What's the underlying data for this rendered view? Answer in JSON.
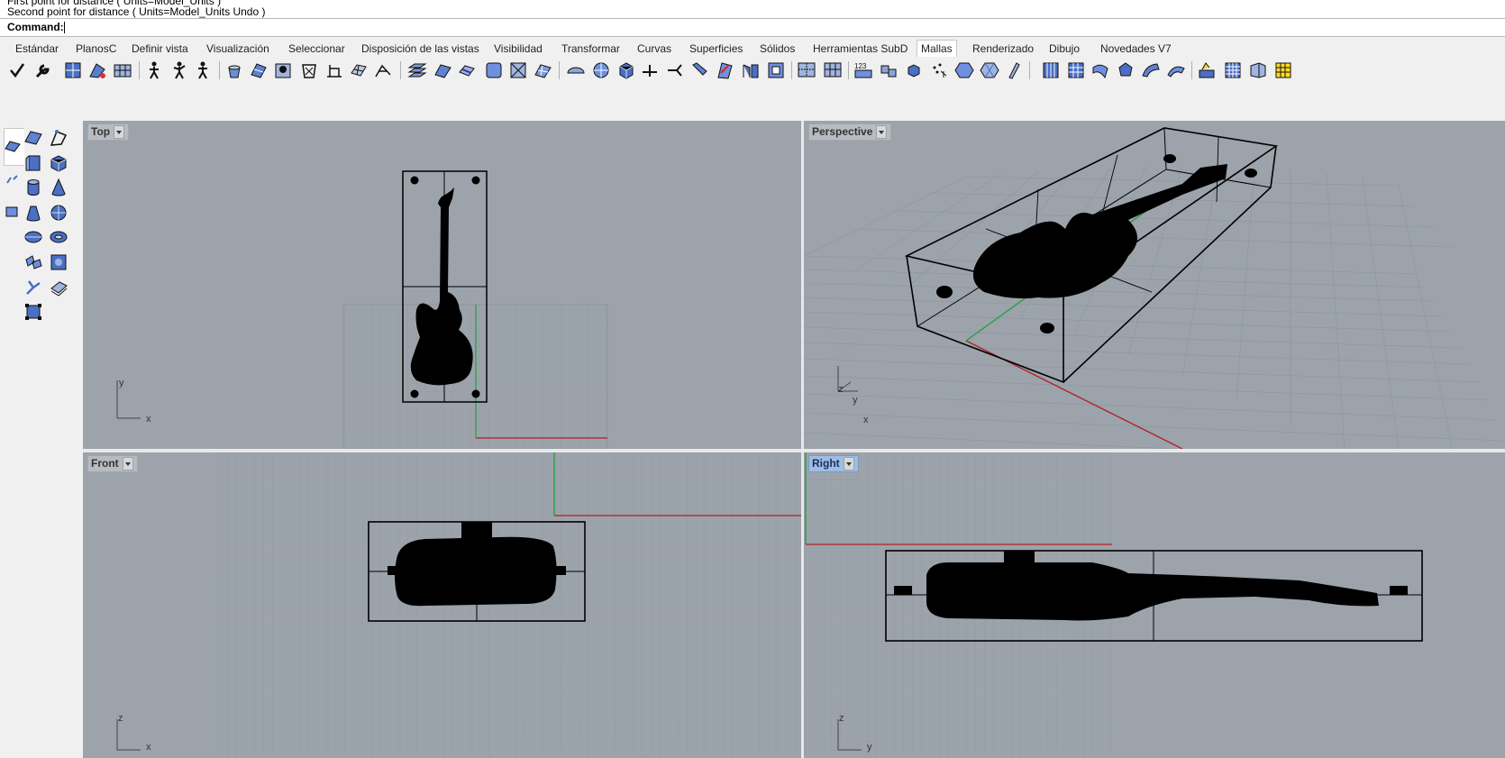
{
  "command_history": [
    "First point for distance ( Units=Model_Units )",
    "Second point for distance ( Units=Model_Units  Undo )"
  ],
  "command": {
    "label": "Command:",
    "value": ""
  },
  "tabs": [
    "Estándar",
    "PlanosC",
    "Definir vista",
    "Visualización",
    "Seleccionar",
    "Disposición de las vistas",
    "Visibilidad",
    "Transformar",
    "Curvas",
    "Superficies",
    "Sólidos",
    "Herramientas SubD",
    "Mallas",
    "Renderizado",
    "Dibujo",
    "Novedades V7"
  ],
  "active_tab": "Mallas",
  "colors": {
    "viewport_bg": "#9ca3ab",
    "grid": "#8e959d",
    "grid_major": "#838a92",
    "x_axis": "#b02020",
    "y_axis": "#20a040",
    "model": "#000000",
    "active_title": "#9dbde6"
  },
  "viewports": {
    "top": {
      "title": "Top",
      "axis_labels": [
        "y",
        "x"
      ]
    },
    "perspective": {
      "title": "Perspective",
      "axis_labels": [
        "z",
        "y",
        "x"
      ]
    },
    "front": {
      "title": "Front",
      "axis_labels": [
        "z",
        "x"
      ]
    },
    "right": {
      "title": "Right",
      "axis_labels": [
        "z",
        "y"
      ],
      "active": true
    }
  },
  "toolbar_icons": [
    "check-icon",
    "wrench-icon",
    "mesh-box-icon",
    "mesh-patch-icon",
    "mesh-grid-icon",
    "walk-person-icon",
    "person-lift-icon",
    "person-icon",
    "bucket-icon",
    "mesh-edit-icon",
    "skull-icon",
    "trash-icon",
    "measure-icon",
    "cube-mesh-icon",
    "project-icon",
    "plane-stack-icon",
    "plane-icon",
    "plane-cut-icon",
    "square-icon",
    "square-grid-icon",
    "plane-mesh-icon",
    "sphere-half-icon",
    "sphere-icon",
    "cube-icon",
    "ruler-icon",
    "pen-icon",
    "cut-icon",
    "flag-icon",
    "split-icon",
    "frame-icon",
    "mesh-split-icon",
    "mesh-join-icon",
    "numbers-icon",
    "cube-explode-icon",
    "cube-small-icon",
    "scatter-icon",
    "hexagon-icon",
    "hexagon-blue-icon",
    "wand-icon",
    "panel-icon",
    "grid-panel-icon",
    "curve-icon",
    "circle-blob-icon",
    "dome-icon",
    "arc-icon",
    "stack-icon",
    "table-icon",
    "tile-icon",
    "highlight-icon"
  ],
  "side_icons": [
    "plane-icon",
    "curve-corner-icon",
    "box-icon",
    "cube-icon",
    "cylinder-icon",
    "cone-icon",
    "truncated-cone-icon",
    "sphere-icon",
    "ellipsoid-icon",
    "torus-icon",
    "mesh-from-nurbs-icon",
    "mesh-patch-icon",
    "mesh-split-icon",
    "mesh-book-icon",
    "mesh-box-small-icon"
  ]
}
